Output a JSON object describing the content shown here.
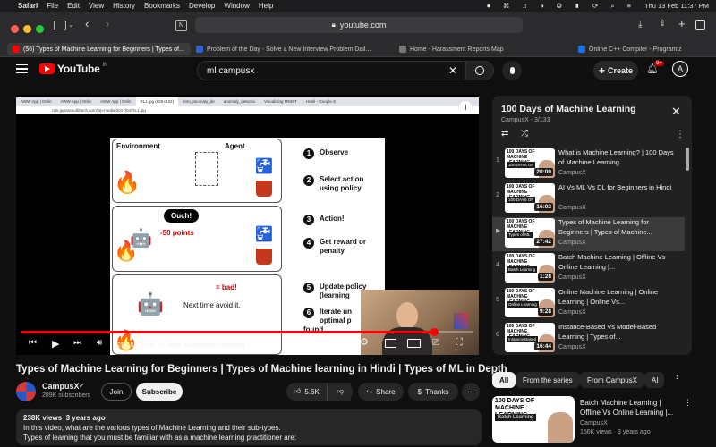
{
  "menubar": {
    "apple": "",
    "items": [
      "Safari",
      "File",
      "Edit",
      "View",
      "History",
      "Bookmarks",
      "Develop",
      "Window",
      "Help"
    ],
    "datetime": "Thu 13 Feb  11:37 PM"
  },
  "browser": {
    "url": "youtube.com",
    "tabs": [
      {
        "label": "(56) Types of Machine Learning for Beginners | Types of..."
      },
      {
        "label": "Problem of the Day - Solve a New Interview Problem Dail..."
      },
      {
        "label": "Home - Harassment Reports Map"
      },
      {
        "label": "Online C++ Compiler - Programiz"
      }
    ]
  },
  "yt": {
    "logo_text": "YouTube",
    "region": "IN",
    "search_value": "ml campusx",
    "create_label": "Create",
    "notif_count": "9+",
    "avatar_letter": "A"
  },
  "video": {
    "inner_url": "cdn.gqjiraseurlittech.com/wp-media/2017/04/RL1.jpg",
    "inner_tabs": [
      "AWW App | Onlin",
      "AWW App | Onlin",
      "AWW App | Onlin",
      "RL1.jpg (800×433)",
      "intro_anomaly_de",
      "anomaly_detectio",
      "Visualizing MNIST",
      "Hotel - Google S"
    ],
    "slide": {
      "env": "Environment",
      "agent": "Agent",
      "ouch": "Ouch!",
      "minus": "-50 points",
      "bad": "= bad!",
      "next": "Next time avoid it.",
      "steps": [
        {
          "n": "1",
          "text": "Observe"
        },
        {
          "n": "2",
          "text": "Select action using policy"
        },
        {
          "n": "3",
          "text": "Action!"
        },
        {
          "n": "4",
          "text": "Get reward or penalty"
        },
        {
          "n": "5",
          "text": "Update policy (learning"
        },
        {
          "n": "6",
          "text": "Iterate un optimal p found"
        }
      ]
    },
    "time": "25:15 / 27:41",
    "chapter": "Semi Supervised Learning",
    "progress": 0.912,
    "title": "Types of Machine Learning for Beginners | Types of Machine learning in Hindi | Types of ML in Depth",
    "channel": "CampusX",
    "subscribers": "289K subscribers",
    "join_label": "Join",
    "subscribe_label": "Subscribe",
    "likes": "5.6K",
    "share_label": "Share",
    "thanks_label": "Thanks",
    "views": "238K views",
    "age": "3 years ago",
    "desc_line1": "In this video, what are the various types of Machine Learning and their sub-types.",
    "desc_line2": "Types of learning that you must be familiar with as a machine learning practitioner are:"
  },
  "playlist": {
    "title": "100 Days of Machine Learning",
    "meta": "CampusX - 3/133",
    "items": [
      {
        "idx": "1",
        "title": "What is Machine Learning? | 100 Days of Machine Learning",
        "channel": "CampusX",
        "dur": "20:00",
        "tag": "100 DAYS OF"
      },
      {
        "idx": "2",
        "title": "AI Vs ML Vs DL for Beginners in Hindi",
        "channel": "CampusX",
        "dur": "16:02",
        "tag": "100 DAYS OF"
      },
      {
        "idx": "▶",
        "title": "Types of Machine Learning for Beginners | Types of Machine...",
        "channel": "CampusX",
        "dur": "27:42",
        "tag": "Types of ML"
      },
      {
        "idx": "4",
        "title": "Batch Machine Learning | Offline Vs Online Learning |...",
        "channel": "CampusX",
        "dur": "1:28",
        "tag": "Batch Learning"
      },
      {
        "idx": "5",
        "title": "Online Machine Learning | Online Learning | Online Vs...",
        "channel": "CampusX",
        "dur": "9:28",
        "tag": "Online Learning"
      },
      {
        "idx": "6",
        "title": "Instance-Based Vs Model-Based Learning | Types of...",
        "channel": "CampusX",
        "dur": "16:44",
        "tag": "Instance Based"
      }
    ]
  },
  "chips": [
    "All",
    "From the series",
    "From CampusX",
    "AI"
  ],
  "rec": {
    "title": "Batch Machine Learning | Offline Vs Online Learning |...",
    "channel": "CampusX",
    "meta": "156K views · 3 years ago",
    "thumb_head": "100 DAYS OF MACHINE LEARNING",
    "thumb_tag": "Batch Learning"
  },
  "colors": {
    "yt_red": "#ff0000",
    "bg": "#0f0f0f",
    "panel": "#212121",
    "text": "#f1f1f1",
    "muted": "#aaaaaa"
  }
}
